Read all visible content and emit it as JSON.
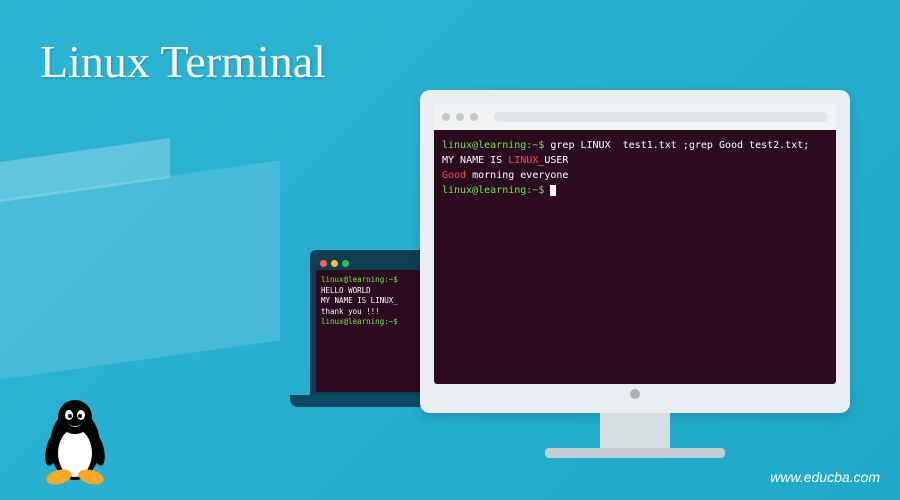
{
  "title": "Linux Terminal",
  "website": "www.educba.com",
  "colors": {
    "bg_accent": "#2db5d4",
    "terminal_bg": "#2c0a20",
    "prompt_green": "#6aed4a",
    "highlight_red": "#ff4d4d"
  },
  "tux_icon": "tux-linux-mascot",
  "monitor": {
    "traffic_dots": 3,
    "prompt": "linux@learning:~$",
    "command": " grep LINUX  test1.txt ;grep Good test2.txt;",
    "output_line1_pre": "MY NAME IS ",
    "output_line1_hl": "LINUX",
    "output_line1_post": "_USER",
    "output_line2_hl": "Good",
    "output_line2_post": " morning everyone",
    "prompt2": "linux@learning:~$ "
  },
  "laptop": {
    "prompt": "linux@learning:~$",
    "line1": "HELLO WORLD",
    "line2": "MY NAME IS LINUX_",
    "line3": "",
    "line4": "thank you !!!",
    "prompt2": "linux@learning:~$"
  }
}
